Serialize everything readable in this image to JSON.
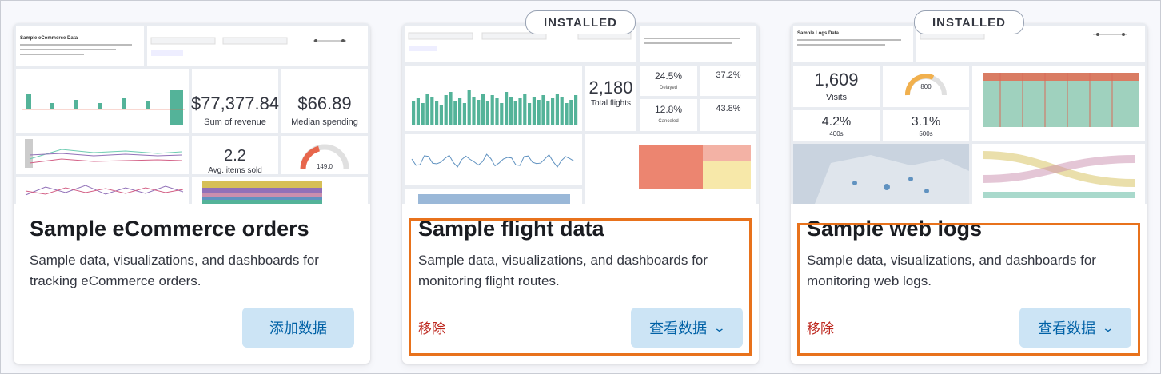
{
  "cards": [
    {
      "title": "Sample eCommerce orders",
      "description": "Sample data, visualizations, and dashboards for tracking eCommerce orders.",
      "button": "添加数据",
      "installed": false,
      "thumbnail": {
        "header_title": "Sample eCommerce Data",
        "stat_revenue": "$77,377.84",
        "stat_revenue_label": "Sum of revenue",
        "stat_median": "$66.89",
        "stat_median_label": "Median spending",
        "stat_items": "2.2",
        "stat_items_label": "Avg. items sold",
        "gauge_value": "149.0"
      }
    },
    {
      "title": "Sample flight data",
      "description": "Sample data, visualizations, and dashboards for monitoring flight routes.",
      "button": "查看数据",
      "remove": "移除",
      "badge": "INSTALLED",
      "installed": true,
      "thumbnail": {
        "stat_total": "2,180",
        "stat_total_label": "Total flights",
        "delayed_pct": "24.5%",
        "delayed_label": "Delayed",
        "canceled_pct": "12.8%",
        "canceled_label": "Canceled",
        "pct_a": "37.2%",
        "pct_b": "43.8%"
      }
    },
    {
      "title": "Sample web logs",
      "description": "Sample data, visualizations, and dashboards for monitoring web logs.",
      "button": "查看数据",
      "remove": "移除",
      "badge": "INSTALLED",
      "installed": true,
      "thumbnail": {
        "header_title": "Sample Logs Data",
        "visits": "1,609",
        "visits_label": "Visits",
        "gauge_value": "800",
        "pct_400": "4.2%",
        "label_400": "400s",
        "pct_500": "3.1%",
        "label_500": "500s"
      }
    }
  ],
  "colors": {
    "accent_button_bg": "#cce4f5",
    "accent_button_text": "#0061a6",
    "danger": "#bd271e",
    "highlight": "#e8721c"
  }
}
